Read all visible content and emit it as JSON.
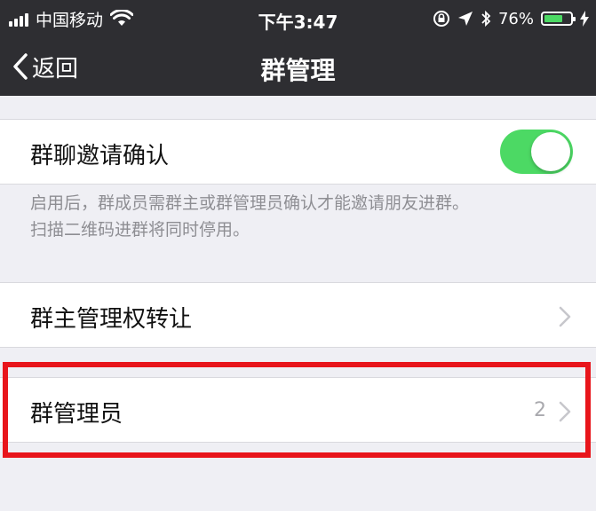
{
  "status_bar": {
    "carrier": "中国移动",
    "time": "下午3:47",
    "battery_percent": "76%",
    "battery_level": 0.76,
    "battery_color": "#4cd964"
  },
  "nav": {
    "back_label": "返回",
    "title": "群管理"
  },
  "settings": {
    "invite_confirm": {
      "label": "群聊邀请确认",
      "enabled": true,
      "description_line1": "启用后，群成员需群主或群管理员确认才能邀请朋友进群。",
      "description_line2": "扫描二维码进群将同时停用。"
    },
    "transfer_owner": {
      "label": "群主管理权转让"
    },
    "admins": {
      "label": "群管理员",
      "value": "2"
    }
  },
  "colors": {
    "highlight": "#e8151b",
    "toggle_on": "#4cd964",
    "nav_background": "#2e2e32"
  },
  "icons": [
    "signal-icon",
    "wifi-icon",
    "orientation-lock-icon",
    "location-icon",
    "bluetooth-icon",
    "battery-icon",
    "charging-icon",
    "back-chevron-icon",
    "chevron-right-icon"
  ]
}
